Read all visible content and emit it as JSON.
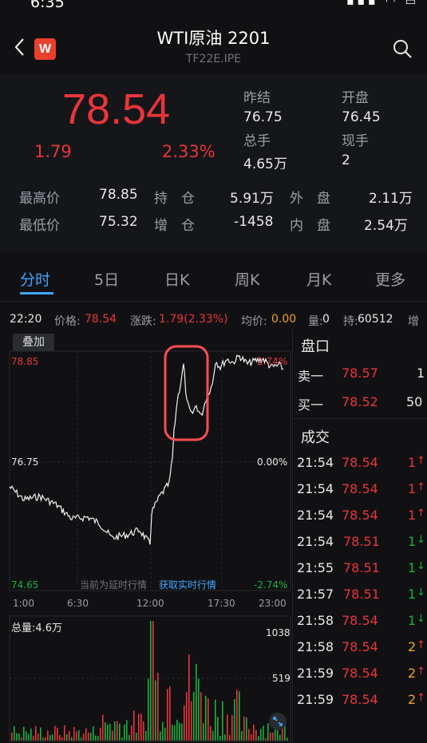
{
  "status": {
    "time": "6:35"
  },
  "nav": {
    "title": "WTI原油 2201",
    "subtitle": "TF22E.IPE",
    "logo": "W"
  },
  "quote": {
    "price": "78.54",
    "change": "1.79",
    "change_pct": "2.33%",
    "prev_settle_label": "昨结",
    "prev_settle": "76.75",
    "open_label": "开盘",
    "open": "76.45",
    "total_vol_label": "总手",
    "total_vol": "4.65万",
    "current_vol_label": "现手",
    "current_vol": "2"
  },
  "stats": {
    "high_label": "最高价",
    "high": "78.85",
    "low_label": "最低价",
    "low": "75.32",
    "oi_label": "持　仓",
    "oi": "5.91万",
    "oi_chg_label": "增　仓",
    "oi_chg": "-1458",
    "outer_label": "外　盘",
    "outer": "2.11万",
    "inner_label": "内　盘",
    "inner": "2.54万"
  },
  "tabs": [
    "分时",
    "5日",
    "日K",
    "周K",
    "月K",
    "更多"
  ],
  "info": {
    "time": "22:20",
    "price_label": "价格:",
    "price": "78.54",
    "chg_label": "涨跌:",
    "chg": "1.79(2.33%)",
    "avg_label": "均价:",
    "avg": "0.00",
    "vol_label": "量:",
    "vol": "0",
    "oi_label": "持:",
    "oi": "60512",
    "more": "增"
  },
  "chart": {
    "overlay": "叠加",
    "y_max": "78.85",
    "y_mid": "76.75",
    "y_min": "74.65",
    "pct_max": "2.74%",
    "pct_mid": "0.00%",
    "pct_min": "-2.74%",
    "delay_note": "当前为延时行情",
    "realtime_link": "获取实时行情",
    "x_ticks": [
      "1:00",
      "6:30",
      "12:00",
      "17:30",
      "23:00"
    ],
    "vol_total": "总量:4.6万",
    "vol_max": "1038",
    "vol_mid": "519",
    "colors": {
      "up": "#e9353a",
      "down": "#19b13f",
      "line": "#f2f2f2",
      "highlight": "#ff4d52"
    }
  },
  "side": {
    "orderbook_title": "盘口",
    "ask_label": "卖一",
    "ask_price": "78.57",
    "ask_qty": "1",
    "bid_label": "买一",
    "bid_price": "78.52",
    "bid_qty": "50",
    "trades_title": "成交",
    "trades": [
      {
        "time": "21:54",
        "price": "78.54",
        "qty": "1",
        "dir": "↑"
      },
      {
        "time": "21:54",
        "price": "78.54",
        "qty": "1",
        "dir": "↑"
      },
      {
        "time": "21:54",
        "price": "78.54",
        "qty": "1",
        "dir": "↑"
      },
      {
        "time": "21:54",
        "price": "78.51",
        "qty": "1",
        "dir": "↓"
      },
      {
        "time": "21:55",
        "price": "78.51",
        "qty": "1",
        "dir": "↓"
      },
      {
        "time": "21:57",
        "price": "78.51",
        "qty": "1",
        "dir": "↓"
      },
      {
        "time": "21:58",
        "price": "78.54",
        "qty": "1",
        "dir": "↓"
      },
      {
        "time": "21:58",
        "price": "78.54",
        "qty": "2",
        "dir": "↑"
      },
      {
        "time": "21:59",
        "price": "78.54",
        "qty": "2",
        "dir": "↑"
      },
      {
        "time": "21:59",
        "price": "78.54",
        "qty": "2",
        "dir": "↑"
      }
    ]
  }
}
